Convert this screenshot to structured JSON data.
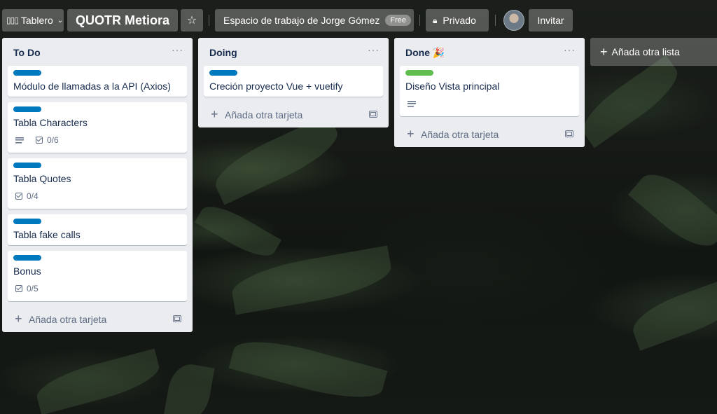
{
  "header": {
    "board_switcher_label": "Tablero",
    "board_title": "QUOTR Metiora",
    "workspace_label": "Espacio de trabajo de Jorge Gómez",
    "workspace_badge": "Free",
    "visibility_label": "Privado",
    "invite_label": "Invitar"
  },
  "lists": [
    {
      "title": "To Do",
      "menu": "···",
      "cards": [
        {
          "label_color": "#0079bf",
          "title": "Módulo de llamadas a la API (Axios)"
        },
        {
          "label_color": "#0079bf",
          "title": "Tabla Characters",
          "has_description": true,
          "checklist": "0/6"
        },
        {
          "label_color": "#0079bf",
          "title": "Tabla Quotes",
          "checklist": "0/4"
        },
        {
          "label_color": "#0079bf",
          "title": "Tabla fake calls"
        },
        {
          "label_color": "#0079bf",
          "title": "Bonus",
          "checklist": "0/5"
        }
      ],
      "add_card_label": "Añada otra tarjeta"
    },
    {
      "title": "Doing",
      "menu": "···",
      "cards": [
        {
          "label_color": "#0079bf",
          "title": "Creción proyecto Vue + vuetify"
        }
      ],
      "add_card_label": "Añada otra tarjeta"
    },
    {
      "title": "Done 🎉",
      "menu": "···",
      "cards": [
        {
          "label_color": "#61bd4f",
          "title": "Diseño Vista principal",
          "has_description": true
        }
      ],
      "add_card_label": "Añada otra tarjeta"
    }
  ],
  "add_list_label": "Añada otra lista",
  "colors": {
    "list_bg": "#ebecf0",
    "label_blue": "#0079bf",
    "label_green": "#61bd4f",
    "text_primary": "#172b4d"
  }
}
